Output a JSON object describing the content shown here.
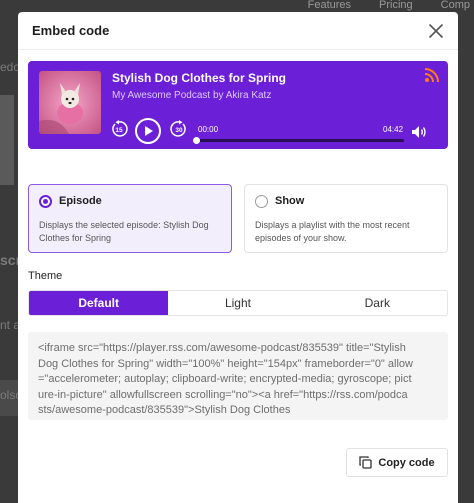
{
  "background": {
    "nav": [
      "Features",
      "Pricing",
      "Comp"
    ],
    "left_fragments": [
      "edc",
      "scri",
      "nt a",
      "olsc"
    ]
  },
  "modal": {
    "title": "Embed code"
  },
  "player": {
    "episode_title": "Stylish Dog Clothes for Spring",
    "podcast_line": "My Awesome Podcast by Akira Katz",
    "time_current": "00:00",
    "time_total": "04:42",
    "progress": 0,
    "rewind_seconds": "15",
    "forward_seconds": "30",
    "accent_color": "#6b1fd6",
    "rss_color": "#ff7a1a"
  },
  "options": [
    {
      "label": "Episode",
      "description": "Displays the selected episode: Stylish Dog Clothes for Spring",
      "selected": true
    },
    {
      "label": "Show",
      "description": "Displays a playlist with the most recent episodes of your show.",
      "selected": false
    }
  ],
  "theme": {
    "label": "Theme",
    "options": [
      "Default",
      "Light",
      "Dark"
    ],
    "selected": "Default"
  },
  "code": "<iframe src=\"https://player.rss.com/awesome-podcast/835539\" title=\"Stylish Dog Clothes for Spring\" width=\"100%\" height=\"154px\" frameborder=\"0\" allow=\"accelerometer; autoplay; clipboard-write; encrypted-media; gyroscope; picture-in-picture\" allowfullscreen scrolling=\"no\"><a href=\"https://rss.com/podcasts/awesome-podcast/835539\">Stylish Dog Clothes",
  "copy_button": "Copy code"
}
